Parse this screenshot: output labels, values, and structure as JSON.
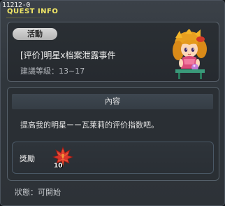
{
  "window": {
    "quest_id": "11212-0",
    "title": "QUEST INFO"
  },
  "quest": {
    "category_badge": "活動",
    "name": "[评价]明星x档案泄露事件",
    "level_label": "建議等級：",
    "level_range": "13~17",
    "npc_icon": "npc-girl-portrait"
  },
  "content": {
    "header": "內容",
    "description": "提高我的明星ーー瓦莱莉的评价指数吧。",
    "reward": {
      "label": "獎勵",
      "item_icon": "maple-leaf-icon",
      "item_quantity": "10"
    }
  },
  "status": {
    "label": "狀態：",
    "value": "可開始"
  },
  "colors": {
    "title_yellow": "#f2e866",
    "panel_bg": "#2a2f34",
    "badge_bg": "#c8c8c8"
  }
}
